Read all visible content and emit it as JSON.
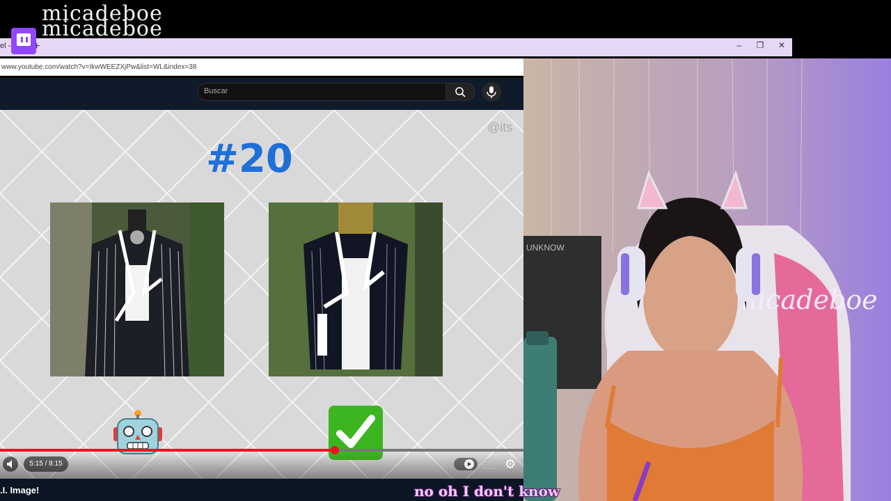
{
  "overlay": {
    "brand_line1": "micadeboe",
    "brand_line2": "micadeboe",
    "subtitle": "no oh I don't know"
  },
  "browser": {
    "tab_title": "el -",
    "new_tab": "+",
    "url": "www.youtube.com/watch?v=IkwWEEZXjPw&list=WL&index=38",
    "window_controls": {
      "minimize": "–",
      "restore": "❐",
      "close": "✕"
    }
  },
  "youtube": {
    "search_placeholder": "Buscar",
    "search_icon": "search-icon",
    "mic_icon": "mic-icon",
    "video": {
      "number": "#20",
      "watermark": "@its",
      "time": "5:15 / 8:15",
      "progress": 0.64,
      "below_title": ".I. Image!"
    }
  },
  "webcam": {
    "neon_sign": "micadeboe",
    "chalkboard": "UNKNOW"
  },
  "colors": {
    "tab_bar": "#e6d8f5",
    "accent_blue": "#1e6fd9",
    "progress_red": "#e9141e",
    "check_green": "#3cb521",
    "subtitle_pink": "#f1c8ff"
  }
}
